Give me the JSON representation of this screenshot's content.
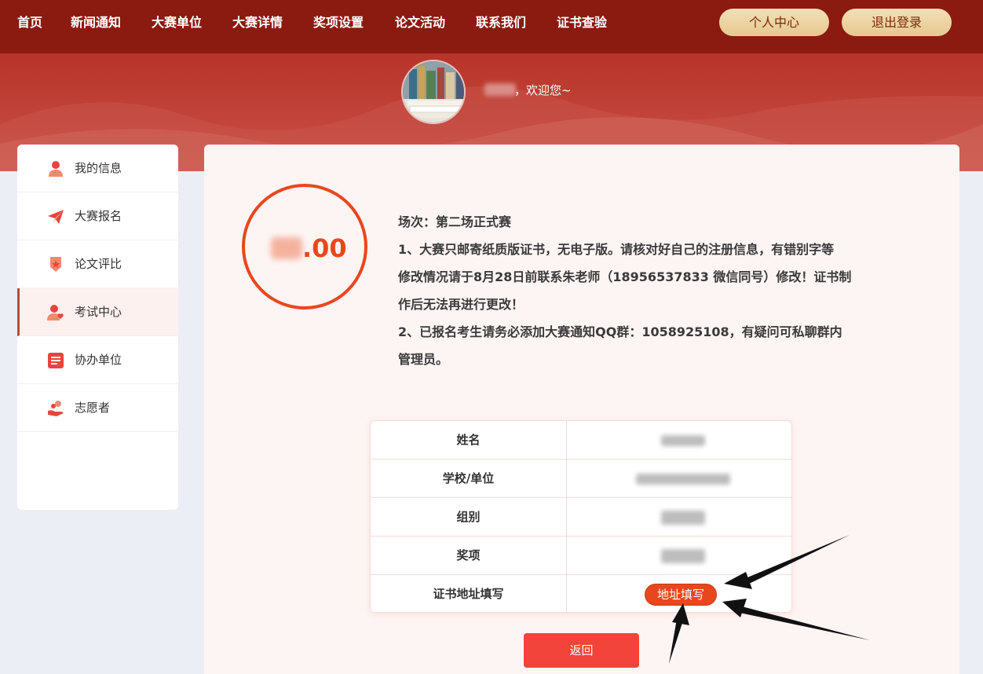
{
  "nav": {
    "items": [
      "首页",
      "新闻通知",
      "大赛单位",
      "大赛详情",
      "奖项设置",
      "论文活动",
      "联系我们",
      "证书查验"
    ],
    "personal_center": "个人中心",
    "logout": "退出登录"
  },
  "header": {
    "welcome": "，欢迎您~"
  },
  "sidebar": {
    "items": [
      {
        "label": "我的信息",
        "icon": "user-icon"
      },
      {
        "label": "大赛报名",
        "icon": "paper-plane-icon"
      },
      {
        "label": "论文评比",
        "icon": "medal-icon"
      },
      {
        "label": "考试中心",
        "icon": "user-heart-icon"
      },
      {
        "label": "协办单位",
        "icon": "list-icon"
      },
      {
        "label": "志愿者",
        "icon": "hand-coin-icon"
      }
    ],
    "active_index": 3
  },
  "score": {
    "suffix": ".00"
  },
  "notice": {
    "session": "场次：第二场正式赛",
    "line1a": "1、大赛只邮寄纸质版证书，无电子版。请核对好自己的注册信息，有错别字等",
    "line1b": "修改情况请于8月28日前联系朱老师（18956537833 微信同号）修改！证书制",
    "line1c": "作后无法再进行更改！",
    "line2a": "2、已报名考生请务必添加大赛通知QQ群：1058925108，有疑问可私聊群内",
    "line2b": "管理员。"
  },
  "table": {
    "rows": [
      "姓名",
      "学校/单位",
      "组别",
      "奖项",
      "证书地址填写"
    ],
    "address_button": "地址填写"
  },
  "back_button": "返回",
  "colors": {
    "nav_bg": "#8b1a10",
    "accent": "#e8471e",
    "button_red": "#f2443a"
  }
}
